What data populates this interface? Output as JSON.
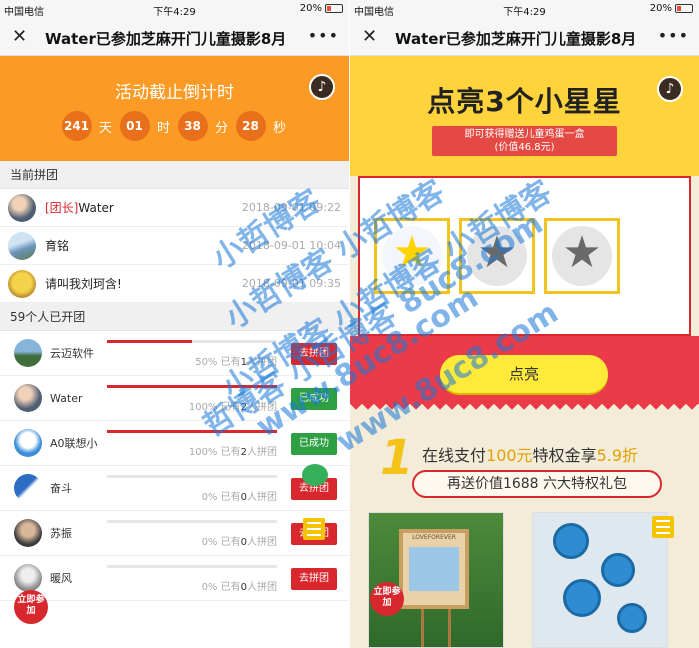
{
  "status_bar": {
    "carrier": "中国电信",
    "time": "下午4:29",
    "battery": "20%"
  },
  "navbar": {
    "close_icon": "close-icon",
    "title": "Water已参加芝麻开门儿童摄影8月",
    "more_icon": "more-icon"
  },
  "left": {
    "countdown": {
      "label": "活动截止倒计时",
      "days": "241",
      "days_unit": "天",
      "hours": "01",
      "hours_unit": "时",
      "minutes": "38",
      "minutes_unit": "分",
      "seconds": "28",
      "seconds_unit": "秒",
      "music_icon": "music-note-icon"
    },
    "current_group": {
      "heading": "当前拼团",
      "members": [
        {
          "tag": "[团长]",
          "name": "Water",
          "time": "2018-09-01 09:22"
        },
        {
          "tag": "",
          "name": "育铭",
          "time": "2018-09-01 10:04"
        },
        {
          "tag": "",
          "name": "请叫我刘珂含!",
          "time": "2018-09-01 09:35"
        }
      ]
    },
    "groups_heading": "59个人已开团",
    "groups": [
      {
        "name": "云迈软件",
        "progress": 50,
        "percent_text": "50%",
        "prefix": "已有",
        "count": "1",
        "suffix": "人拼团",
        "button": "去拼团",
        "done": false
      },
      {
        "name": "Water",
        "progress": 100,
        "percent_text": "100%",
        "prefix": "已有",
        "count": "2",
        "suffix": "人拼团",
        "button": "已成功",
        "done": true
      },
      {
        "name": "A0联想小",
        "progress": 100,
        "percent_text": "100%",
        "prefix": "已有",
        "count": "2",
        "suffix": "人拼团",
        "button": "已成功",
        "done": true
      },
      {
        "name": "奋斗",
        "progress": 0,
        "percent_text": "0%",
        "prefix": "已有",
        "count": "0",
        "suffix": "人拼团",
        "button": "去拼团",
        "done": false
      },
      {
        "name": "苏振",
        "progress": 0,
        "percent_text": "0%",
        "prefix": "已有",
        "count": "0",
        "suffix": "人拼团",
        "button": "去拼团",
        "done": false
      },
      {
        "name": "暖风",
        "progress": 0,
        "percent_text": "0%",
        "prefix": "已有",
        "count": "0",
        "suffix": "人拼团",
        "button": "去拼团",
        "done": false
      }
    ],
    "float_join": "立即参加"
  },
  "right": {
    "headline": "点亮3个小星星",
    "ribbon_line1": "即可获得赠送儿童鸡蛋一盒",
    "ribbon_line2": "(价值46.8元)",
    "stars": [
      {
        "lit": true
      },
      {
        "lit": false
      },
      {
        "lit": false
      }
    ],
    "light_button": "点亮",
    "promo": {
      "number": "1",
      "line1_prefix": "在线支付",
      "line1_amount": "100元",
      "line1_mid": "特权金享",
      "line1_discount": "5.9折",
      "line2": "再送价值1688 六大特权礼包",
      "card1_caption": "LOVEFOREVER"
    },
    "float_join": "立即参加"
  },
  "watermark": [
    "小哲博客",
    "小哲博客 小哲博客",
    "小哲博客 小哲博客 小哲博客",
    "哲博客 小哲博客 8uc8.com",
    "www.8uc8.com",
    "www.8uc8.com"
  ],
  "colors": {
    "orange": "#fb9a24",
    "red": "#d9272e",
    "yellow": "#ffd33b",
    "green": "#2ea043",
    "watermark": "#1978d7"
  }
}
